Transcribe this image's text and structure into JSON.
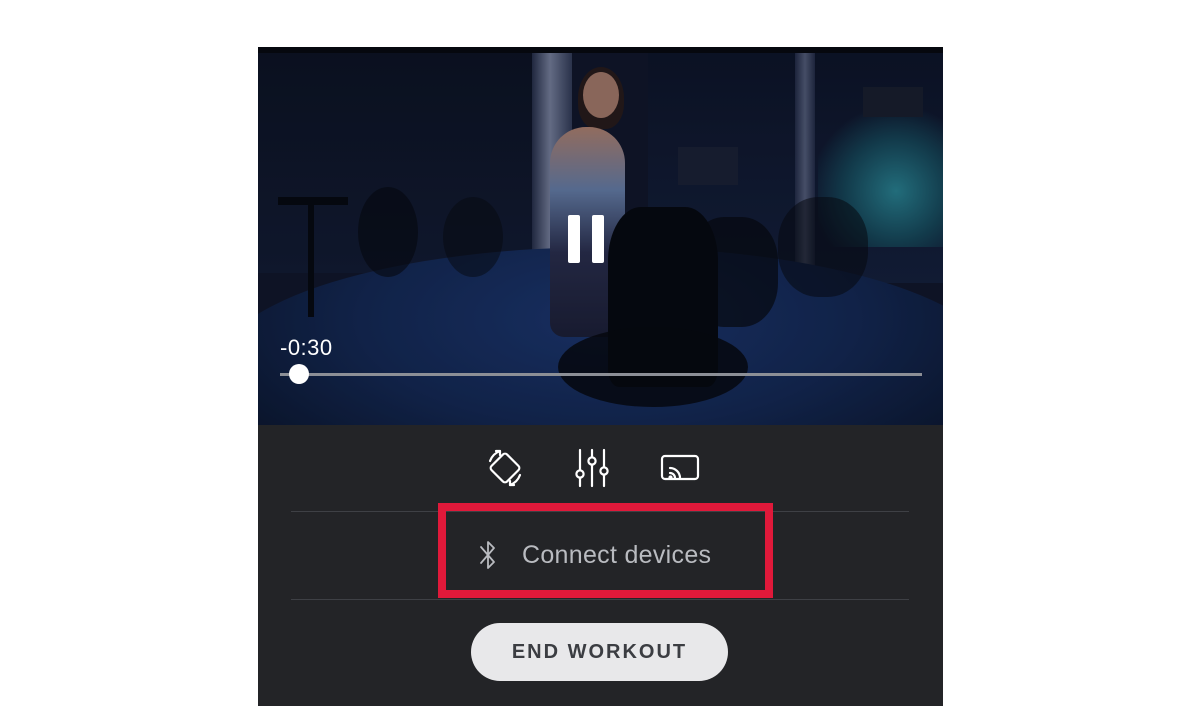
{
  "player": {
    "time_remaining": "-0:30",
    "progress_fraction": 0.03,
    "state": "playing",
    "pause_icon": "pause-icon"
  },
  "controls": {
    "icons": [
      "screen-rotate-icon",
      "sliders-icon",
      "cast-icon"
    ]
  },
  "devices": {
    "connect_label": "Connect devices",
    "icon": "bluetooth-icon"
  },
  "actions": {
    "end_workout_label": "END WORKOUT"
  },
  "colors": {
    "highlight": "#e0193a",
    "panel_background": "#232427",
    "button_background": "#e8e8ea"
  }
}
